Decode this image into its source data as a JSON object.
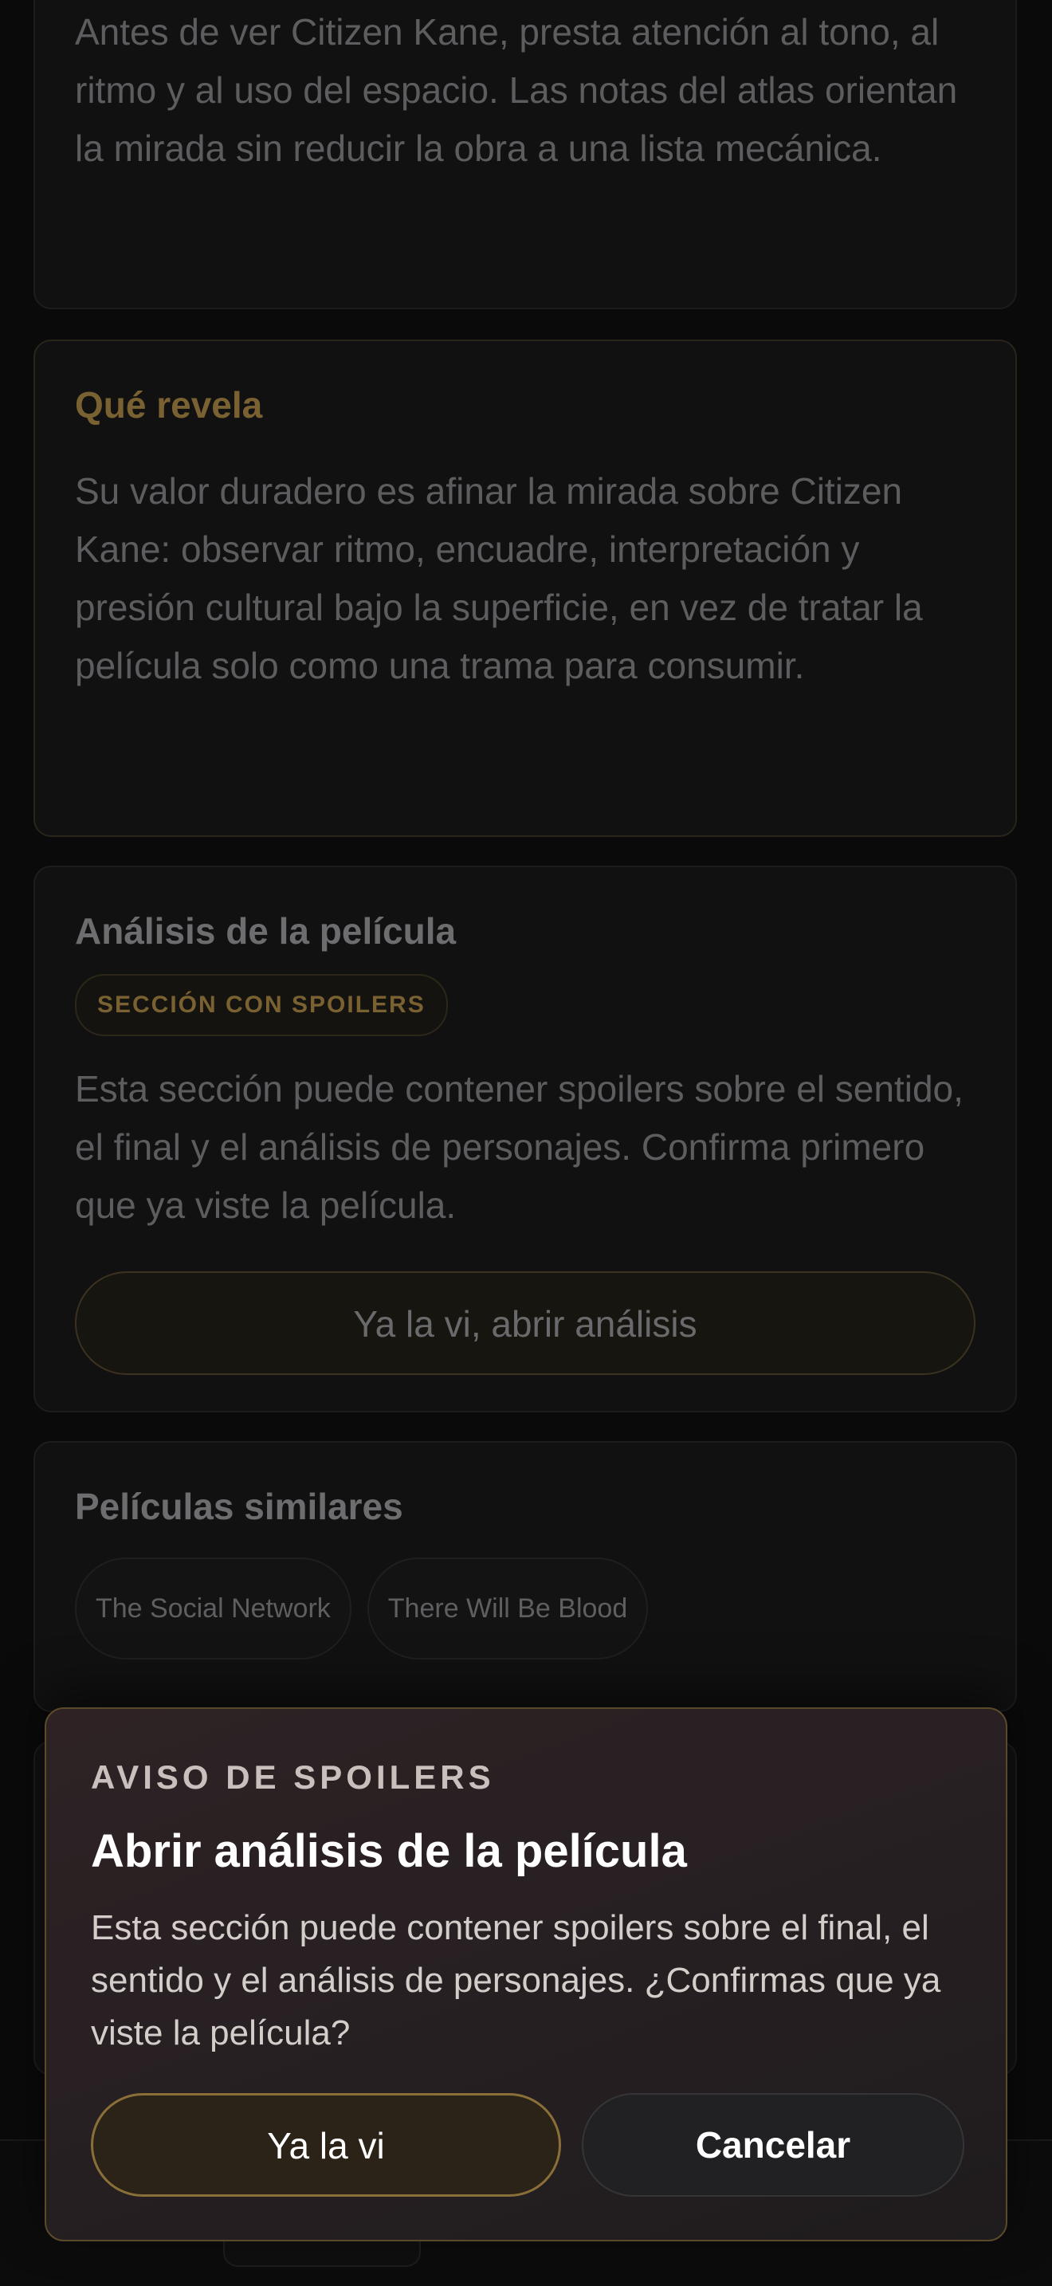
{
  "intro": {
    "text": "Antes de ver Citizen Kane, presta atención al tono, al ritmo y al uso del espacio. Las notas del atlas orientan la mirada sin reducir la obra a una lista mecánica."
  },
  "reveals": {
    "title": "Qué revela",
    "text": "Su valor duradero es afinar la mirada sobre Citizen Kane: observar ritmo, encuadre, interpretación y presión cultural bajo la superficie, en vez de tratar la película solo como una trama para consumir."
  },
  "analysis": {
    "title": "Análisis de la película",
    "badge": "SECCIÓN CON SPOILERS",
    "text": "Esta sección puede contener spoilers sobre el sentido, el final y el análisis de personajes. Confirma primero que ya viste la película.",
    "button_label": "Ya la vi, abrir análisis"
  },
  "similar": {
    "title": "Películas similares",
    "items": [
      "The Social Network",
      "There Will Be Blood"
    ]
  },
  "modal": {
    "kicker": "AVISO DE SPOILERS",
    "title": "Abrir análisis de la película",
    "body": "Esta sección puede contener spoilers sobre el final, el sentido y el análisis de personajes. ¿Confirmas que ya viste la película?",
    "confirm_label": "Ya la vi",
    "cancel_label": "Cancelar"
  },
  "colors": {
    "accent_gold": "#8a7038",
    "background": "#0a0a0b",
    "modal_background": "#2b2123"
  }
}
